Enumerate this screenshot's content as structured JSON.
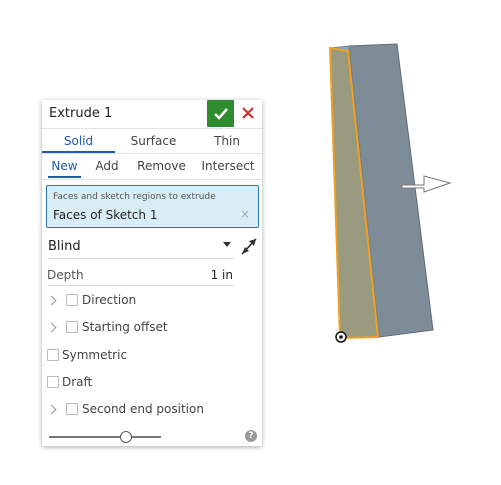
{
  "dialog": {
    "title": "Extrude 1",
    "confirm_icon": "checkmark-icon",
    "cancel_icon": "close-icon",
    "accent_color": "#1f5ba8",
    "confirm_color": "#2e8b2e",
    "cancel_color": "#d32f2f"
  },
  "body_tabs": [
    "Solid",
    "Surface",
    "Thin"
  ],
  "op_tabs": [
    "New",
    "Add",
    "Remove",
    "Intersect"
  ],
  "selection": {
    "placeholder": "Faces and sketch regions to extrude",
    "value": "Faces of Sketch 1",
    "clear_symbol": "×"
  },
  "end_type": "Blind",
  "depth": {
    "label": "Depth",
    "value": "1 in"
  },
  "options": {
    "direction": "Direction",
    "starting_offset": "Starting offset",
    "symmetric": "Symmetric",
    "draft": "Draft",
    "second_end": "Second end position"
  },
  "help_symbol": "?"
}
